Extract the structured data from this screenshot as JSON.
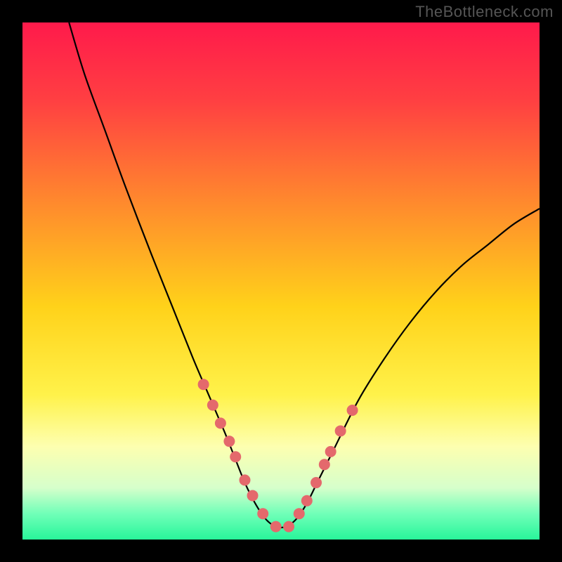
{
  "watermark": "TheBottleneck.com",
  "chart_data": {
    "type": "line",
    "title": "",
    "xlabel": "",
    "ylabel": "",
    "xlim": [
      0,
      100
    ],
    "ylim": [
      0,
      100
    ],
    "background_gradient_stops": [
      {
        "offset": 0.0,
        "color": "#ff1a4b"
      },
      {
        "offset": 0.15,
        "color": "#ff3f42"
      },
      {
        "offset": 0.35,
        "color": "#ff8a2d"
      },
      {
        "offset": 0.55,
        "color": "#ffd21a"
      },
      {
        "offset": 0.72,
        "color": "#fff24a"
      },
      {
        "offset": 0.82,
        "color": "#fdffb0"
      },
      {
        "offset": 0.9,
        "color": "#d6ffcb"
      },
      {
        "offset": 0.95,
        "color": "#70ffb8"
      },
      {
        "offset": 1.0,
        "color": "#28f59a"
      }
    ],
    "series": [
      {
        "name": "bottleneck-curve",
        "color": "#000000",
        "x": [
          9,
          12,
          16,
          20,
          25,
          29,
          33,
          36,
          39,
          41,
          43,
          45,
          47,
          49,
          51,
          53,
          55,
          57,
          60,
          65,
          70,
          75,
          80,
          85,
          90,
          95,
          100
        ],
        "y": [
          100,
          90,
          79,
          68,
          55,
          45,
          35,
          28,
          21,
          16,
          11,
          7,
          4,
          2.5,
          2.5,
          4,
          7,
          11,
          17,
          27,
          35,
          42,
          48,
          53,
          57,
          61,
          64
        ]
      }
    ],
    "markers": {
      "name": "highlight-points",
      "color": "#e4696c",
      "radius": 8,
      "x": [
        35.0,
        36.8,
        38.3,
        40.0,
        41.2,
        43.0,
        44.5,
        46.5,
        49.0,
        51.5,
        53.5,
        55.0,
        56.8,
        58.4,
        59.6,
        61.5,
        63.8
      ],
      "y": [
        30.0,
        26.0,
        22.5,
        19.0,
        16.0,
        11.5,
        8.5,
        5.0,
        2.5,
        2.5,
        5.0,
        7.5,
        11.0,
        14.5,
        17.0,
        21.0,
        25.0
      ]
    }
  }
}
